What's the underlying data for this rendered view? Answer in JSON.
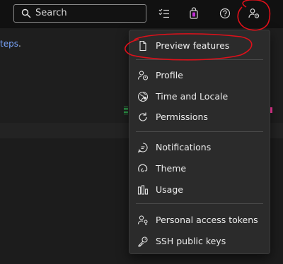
{
  "header": {
    "search": {
      "label": "Search",
      "icon": "search-icon"
    },
    "icons": [
      "task-list-icon",
      "shopping-bag-icon",
      "help-icon",
      "user-settings-icon"
    ]
  },
  "background": {
    "link_text": "teps",
    "link_suffix": "."
  },
  "menu": {
    "items": [
      {
        "label": "Preview features",
        "icon": "document-icon"
      },
      {
        "label": "Profile",
        "icon": "profile-icon"
      },
      {
        "label": "Time and Locale",
        "icon": "globe-icon"
      },
      {
        "label": "Permissions",
        "icon": "refresh-icon"
      },
      {
        "label": "Notifications",
        "icon": "chat-icon"
      },
      {
        "label": "Theme",
        "icon": "theme-icon"
      },
      {
        "label": "Usage",
        "icon": "bar-chart-icon"
      },
      {
        "label": "Personal access tokens",
        "icon": "person-key-icon"
      },
      {
        "label": "SSH public keys",
        "icon": "key-icon"
      }
    ]
  },
  "colors": {
    "accent_link": "#7aa7ff",
    "annotation": "#e0101a",
    "menu_bg": "#2b2b2b",
    "topbar_bg": "#111111"
  }
}
